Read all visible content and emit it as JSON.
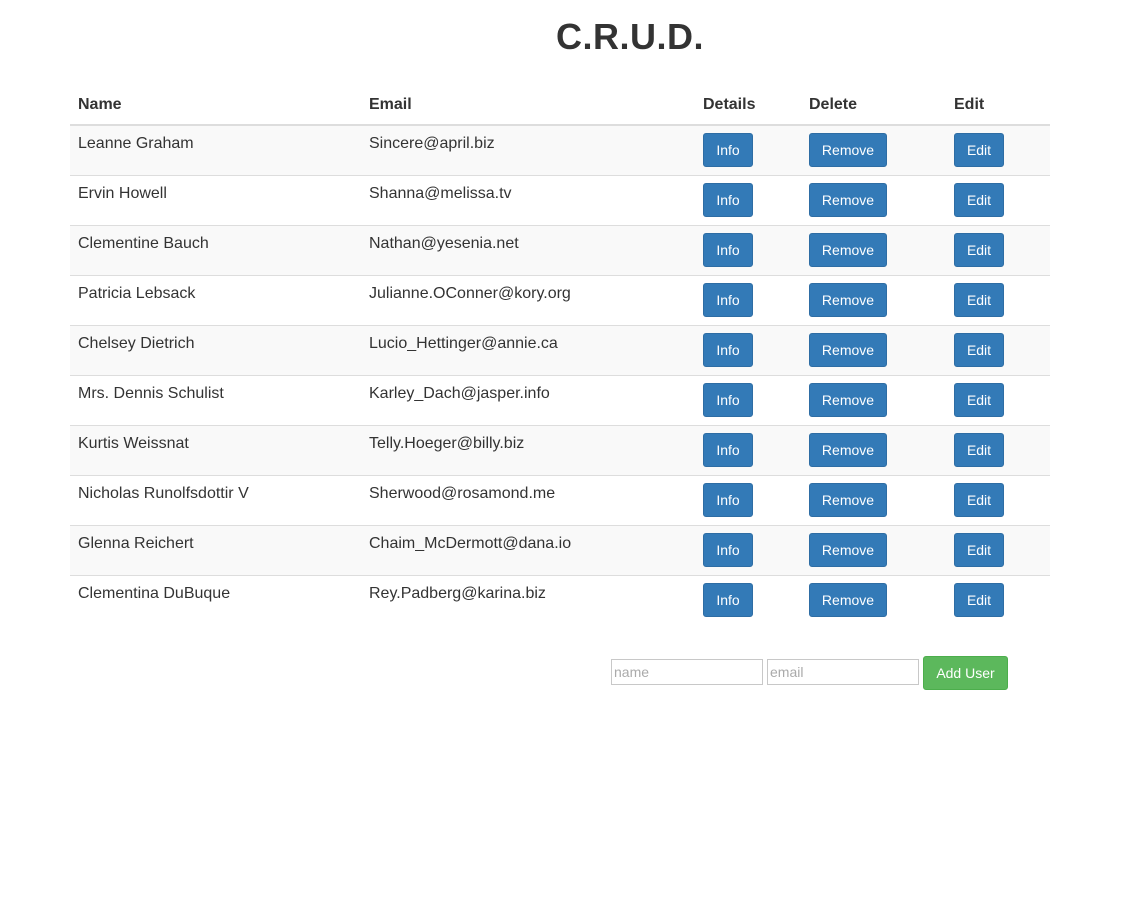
{
  "title": "C.R.U.D.",
  "table": {
    "headers": {
      "name": "Name",
      "email": "Email",
      "details": "Details",
      "delete": "Delete",
      "edit": "Edit"
    },
    "rows": [
      {
        "name": "Leanne Graham",
        "email": "Sincere@april.biz"
      },
      {
        "name": "Ervin Howell",
        "email": "Shanna@melissa.tv"
      },
      {
        "name": "Clementine Bauch",
        "email": "Nathan@yesenia.net"
      },
      {
        "name": "Patricia Lebsack",
        "email": "Julianne.OConner@kory.org"
      },
      {
        "name": "Chelsey Dietrich",
        "email": "Lucio_Hettinger@annie.ca"
      },
      {
        "name": "Mrs. Dennis Schulist",
        "email": "Karley_Dach@jasper.info"
      },
      {
        "name": "Kurtis Weissnat",
        "email": "Telly.Hoeger@billy.biz"
      },
      {
        "name": "Nicholas Runolfsdottir V",
        "email": "Sherwood@rosamond.me"
      },
      {
        "name": "Glenna Reichert",
        "email": "Chaim_McDermott@dana.io"
      },
      {
        "name": "Clementina DuBuque",
        "email": "Rey.Padberg@karina.biz"
      }
    ],
    "info_label": "Info",
    "remove_label": "Remove",
    "edit_label": "Edit"
  },
  "add_form": {
    "name_placeholder": "name",
    "email_placeholder": "email",
    "name_value": "",
    "email_value": "",
    "add_label": "Add User"
  },
  "colors": {
    "primary": "#337ab7",
    "success": "#5cb85c",
    "stripe": "#f9f9f9",
    "border": "#dddddd"
  }
}
